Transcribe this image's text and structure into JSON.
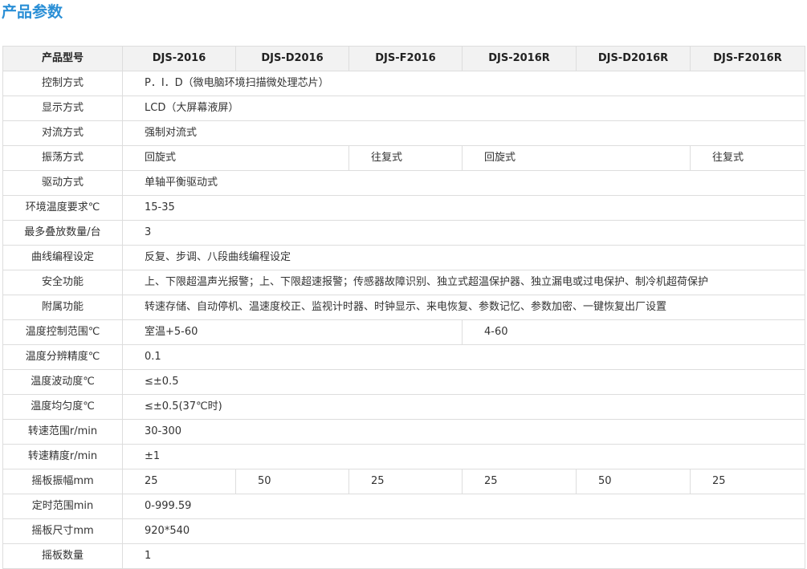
{
  "page": {
    "title": "产品参数",
    "title_color": "#2a8fd6"
  },
  "table": {
    "header": {
      "label": "产品型号",
      "models": [
        "DJS-2016",
        "DJS-D2016",
        "DJS-F2016",
        "DJS-2016R",
        "DJS-D2016R",
        "DJS-F2016R"
      ]
    },
    "rows": [
      {
        "label": "控制方式",
        "cells": [
          "P．I．D（微电脑环境扫描微处理芯片）"
        ]
      },
      {
        "label": "显示方式",
        "cells": [
          "LCD（大屏幕液屏）"
        ]
      },
      {
        "label": "对流方式",
        "cells": [
          "强制对流式"
        ]
      },
      {
        "label": "振荡方式",
        "cells": [
          "回旋式",
          "往复式",
          "回旋式",
          "往复式"
        ]
      },
      {
        "label": "驱动方式",
        "cells": [
          "单轴平衡驱动式"
        ]
      },
      {
        "label": "环境温度要求℃",
        "cells": [
          "15-35"
        ]
      },
      {
        "label": "最多叠放数量/台",
        "cells": [
          "3"
        ]
      },
      {
        "label": "曲线编程设定",
        "cells": [
          "反复、步调、八段曲线编程设定"
        ]
      },
      {
        "label": "安全功能",
        "cells": [
          "上、下限超温声光报警；上、下限超速报警；传感器故障识别、独立式超温保护器、独立漏电或过电保护、制冷机超荷保护"
        ]
      },
      {
        "label": "附属功能",
        "cells": [
          "转速存储、自动停机、温速度校正、监视计时器、时钟显示、来电恢复、参数记忆、参数加密、一键恢复出厂设置"
        ]
      },
      {
        "label": "温度控制范围℃",
        "cells": [
          "室温+5-60",
          "4-60"
        ]
      },
      {
        "label": "温度分辨精度℃",
        "cells": [
          "0.1"
        ]
      },
      {
        "label": "温度波动度℃",
        "cells": [
          "≤±0.5"
        ]
      },
      {
        "label": "温度均匀度℃",
        "cells": [
          "≤±0.5(37℃时)"
        ]
      },
      {
        "label": "转速范围r/min",
        "cells": [
          "30-300"
        ]
      },
      {
        "label": "转速精度r/min",
        "cells": [
          "±1"
        ]
      },
      {
        "label": "摇板振幅mm",
        "cells": [
          "25",
          "50",
          "25",
          "25",
          "50",
          "25"
        ]
      },
      {
        "label": "定时范围min",
        "cells": [
          "0-999.59"
        ]
      },
      {
        "label": "摇板尺寸mm",
        "cells": [
          "920*540"
        ]
      },
      {
        "label": "摇板数量",
        "cells": [
          "1"
        ]
      }
    ]
  }
}
